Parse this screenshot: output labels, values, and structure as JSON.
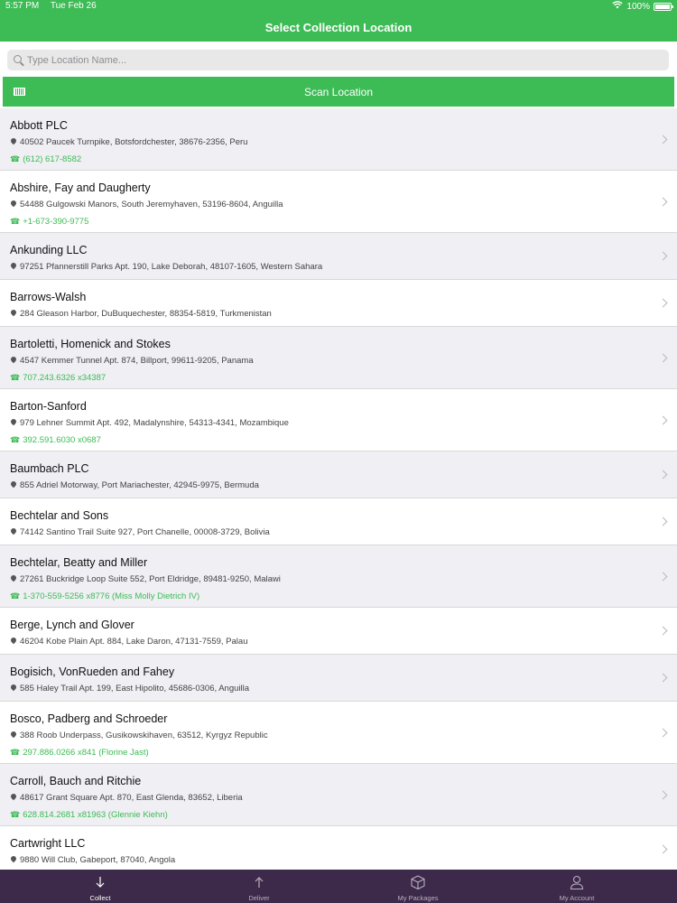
{
  "status_bar": {
    "time": "5:57 PM",
    "date": "Tue Feb 26",
    "battery": "100%"
  },
  "nav": {
    "title": "Select Collection Location"
  },
  "search": {
    "placeholder": "Type Location Name..."
  },
  "scan": {
    "label": "Scan Location"
  },
  "locations": [
    {
      "name": "Abbott PLC",
      "address": "40502 Paucek Turnpike, Botsfordchester, 38676-2356, Peru",
      "phone": "(612) 617-8582"
    },
    {
      "name": "Abshire, Fay and Daugherty",
      "address": "54488 Gulgowski Manors, South Jeremyhaven, 53196-8604, Anguilla",
      "phone": "+1-673-390-9775"
    },
    {
      "name": "Ankunding LLC",
      "address": "97251 Pfannerstill Parks Apt. 190, Lake Deborah, 48107-1605, Western Sahara",
      "phone": ""
    },
    {
      "name": "Barrows-Walsh",
      "address": "284 Gleason Harbor, DuBuquechester, 88354-5819, Turkmenistan",
      "phone": ""
    },
    {
      "name": "Bartoletti, Homenick and Stokes",
      "address": "4547 Kemmer Tunnel Apt. 874, Billport, 99611-9205, Panama",
      "phone": "707.243.6326 x34387"
    },
    {
      "name": "Barton-Sanford",
      "address": "979 Lehner Summit Apt. 492, Madalynshire, 54313-4341, Mozambique",
      "phone": "392.591.6030 x0687"
    },
    {
      "name": "Baumbach PLC",
      "address": "855 Adriel Motorway, Port Mariachester, 42945-9975, Bermuda",
      "phone": ""
    },
    {
      "name": "Bechtelar and Sons",
      "address": "74142 Santino Trail Suite 927, Port Chanelle, 00008-3729, Bolivia",
      "phone": ""
    },
    {
      "name": "Bechtelar, Beatty and Miller",
      "address": "27261 Buckridge Loop Suite 552, Port Eldridge, 89481-9250, Malawi",
      "phone": "1-370-559-5256 x8776 (Miss Molly Dietrich IV)"
    },
    {
      "name": "Berge, Lynch and Glover",
      "address": "46204 Kobe Plain Apt. 884, Lake Daron, 47131-7559, Palau",
      "phone": ""
    },
    {
      "name": "Bogisich, VonRueden and Fahey",
      "address": "585 Haley Trail Apt. 199, East Hipolito, 45686-0306, Anguilla",
      "phone": ""
    },
    {
      "name": "Bosco, Padberg and Schroeder",
      "address": "388 Roob Underpass, Gusikowskihaven, 63512, Kyrgyz Republic",
      "phone": "297.886.0266 x841 (Florine Jast)"
    },
    {
      "name": "Carroll, Bauch and Ritchie",
      "address": "48617 Grant Square Apt. 870, East Glenda, 83652, Liberia",
      "phone": "628.814.2681 x81963 (Glennie Kiehn)"
    },
    {
      "name": "Cartwright LLC",
      "address": "9880 Will Club, Gabeport, 87040, Angola",
      "phone": ""
    }
  ],
  "tabs": [
    {
      "label": "Collect",
      "icon": "arrow-down-icon",
      "active": true
    },
    {
      "label": "Deliver",
      "icon": "arrow-up-icon",
      "active": false
    },
    {
      "label": "My Packages",
      "icon": "box-icon",
      "active": false
    },
    {
      "label": "My Account",
      "icon": "person-icon",
      "active": false
    }
  ],
  "colors": {
    "primary": "#3dbb55",
    "tab_bar": "#3d2a4a",
    "row_alt": "#efeff4"
  }
}
